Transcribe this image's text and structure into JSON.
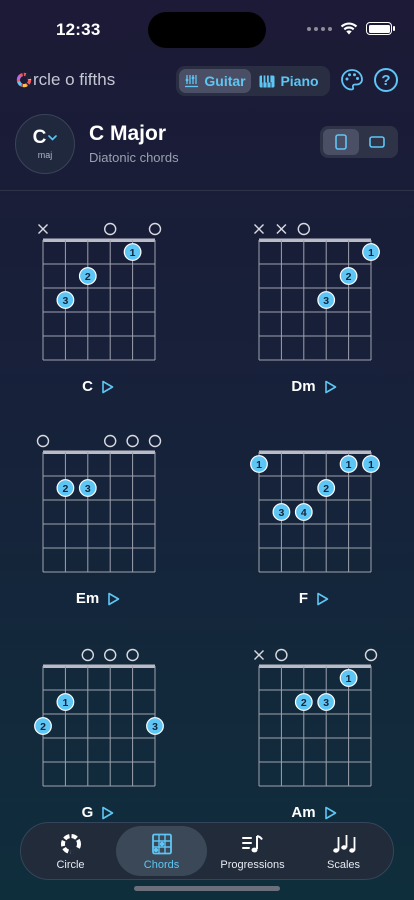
{
  "status": {
    "time": "12:33"
  },
  "header": {
    "app_title": "rcle o fifths",
    "instrument_toggle": {
      "guitar": "Guitar",
      "piano": "Piano",
      "selected": "Guitar"
    }
  },
  "key": {
    "letter": "C",
    "mode": "maj",
    "title": "C Major",
    "subtitle": "Diatonic chords"
  },
  "chords": [
    {
      "name": "C",
      "strings": [
        "x",
        "",
        "",
        "o",
        "",
        "o"
      ],
      "fingers": [
        {
          "string": 5,
          "fret": 1,
          "label": "1"
        },
        {
          "string": 3,
          "fret": 2,
          "label": "2"
        },
        {
          "string": 2,
          "fret": 3,
          "label": "3"
        }
      ]
    },
    {
      "name": "Dm",
      "strings": [
        "x",
        "x",
        "o",
        "",
        "",
        ""
      ],
      "fingers": [
        {
          "string": 6,
          "fret": 1,
          "label": "1"
        },
        {
          "string": 5,
          "fret": 2,
          "label": "2"
        },
        {
          "string": 4,
          "fret": 3,
          "label": "3"
        }
      ]
    },
    {
      "name": "Em",
      "strings": [
        "o",
        "",
        "",
        "o",
        "o",
        "o"
      ],
      "fingers": [
        {
          "string": 2,
          "fret": 2,
          "label": "2"
        },
        {
          "string": 3,
          "fret": 2,
          "label": "3"
        }
      ]
    },
    {
      "name": "F",
      "strings": [
        "",
        "",
        "",
        "",
        "",
        ""
      ],
      "fingers": [
        {
          "string": 1,
          "fret": 1,
          "label": "1"
        },
        {
          "string": 5,
          "fret": 1,
          "label": "1"
        },
        {
          "string": 6,
          "fret": 1,
          "label": "1"
        },
        {
          "string": 4,
          "fret": 2,
          "label": "2"
        },
        {
          "string": 2,
          "fret": 3,
          "label": "3"
        },
        {
          "string": 3,
          "fret": 3,
          "label": "4"
        }
      ]
    },
    {
      "name": "G",
      "strings": [
        "",
        "",
        "o",
        "o",
        "o",
        ""
      ],
      "fingers": [
        {
          "string": 2,
          "fret": 2,
          "label": "1"
        },
        {
          "string": 1,
          "fret": 3,
          "label": "2"
        },
        {
          "string": 6,
          "fret": 3,
          "label": "3"
        }
      ]
    },
    {
      "name": "Am",
      "strings": [
        "x",
        "o",
        "",
        "",
        "",
        "o"
      ],
      "fingers": [
        {
          "string": 5,
          "fret": 1,
          "label": "1"
        },
        {
          "string": 3,
          "fret": 2,
          "label": "2"
        },
        {
          "string": 4,
          "fret": 2,
          "label": "3"
        }
      ]
    }
  ],
  "tabs": [
    {
      "label": "Circle",
      "icon": "circle-icon"
    },
    {
      "label": "Chords",
      "icon": "chord-grid-icon",
      "active": true
    },
    {
      "label": "Progressions",
      "icon": "progressions-icon"
    },
    {
      "label": "Scales",
      "icon": "scales-icon"
    }
  ],
  "colors": {
    "accent": "#5ec6f5",
    "finger_dot": "#5ec6f5",
    "background": "#1b1f38"
  }
}
